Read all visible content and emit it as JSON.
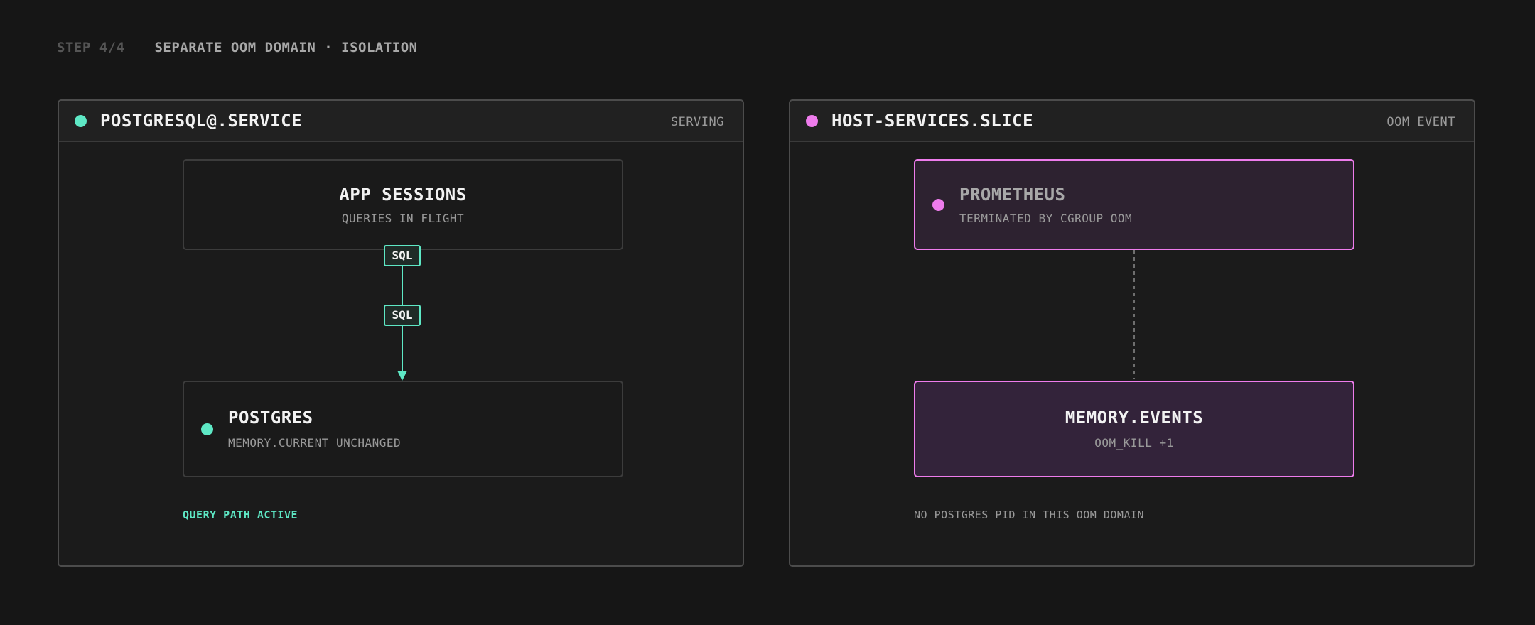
{
  "header": {
    "step": "STEP 4/4",
    "title": "SEPARATE OOM DOMAIN · ISOLATION"
  },
  "colors": {
    "accent_green": "#5ee8c5",
    "accent_pink": "#ee7cec",
    "background": "#161616"
  },
  "left_panel": {
    "title": "POSTGRESQL@.SERVICE",
    "status": "SERVING",
    "app_sessions": {
      "title": "APP SESSIONS",
      "subtitle": "QUERIES IN FLIGHT"
    },
    "connector_tags": [
      "SQL",
      "SQL"
    ],
    "postgres": {
      "title": "POSTGRES",
      "subtitle": "MEMORY.CURRENT UNCHANGED"
    },
    "footnote": "QUERY PATH ACTIVE"
  },
  "right_panel": {
    "title": "HOST-SERVICES.SLICE",
    "status": "OOM EVENT",
    "prometheus": {
      "title": "PROMETHEUS",
      "subtitle": "TERMINATED BY CGROUP OOM"
    },
    "memory_events": {
      "title": "MEMORY.EVENTS",
      "subtitle": "OOM_KILL +1"
    },
    "footnote": "NO POSTGRES PID IN THIS OOM DOMAIN"
  }
}
